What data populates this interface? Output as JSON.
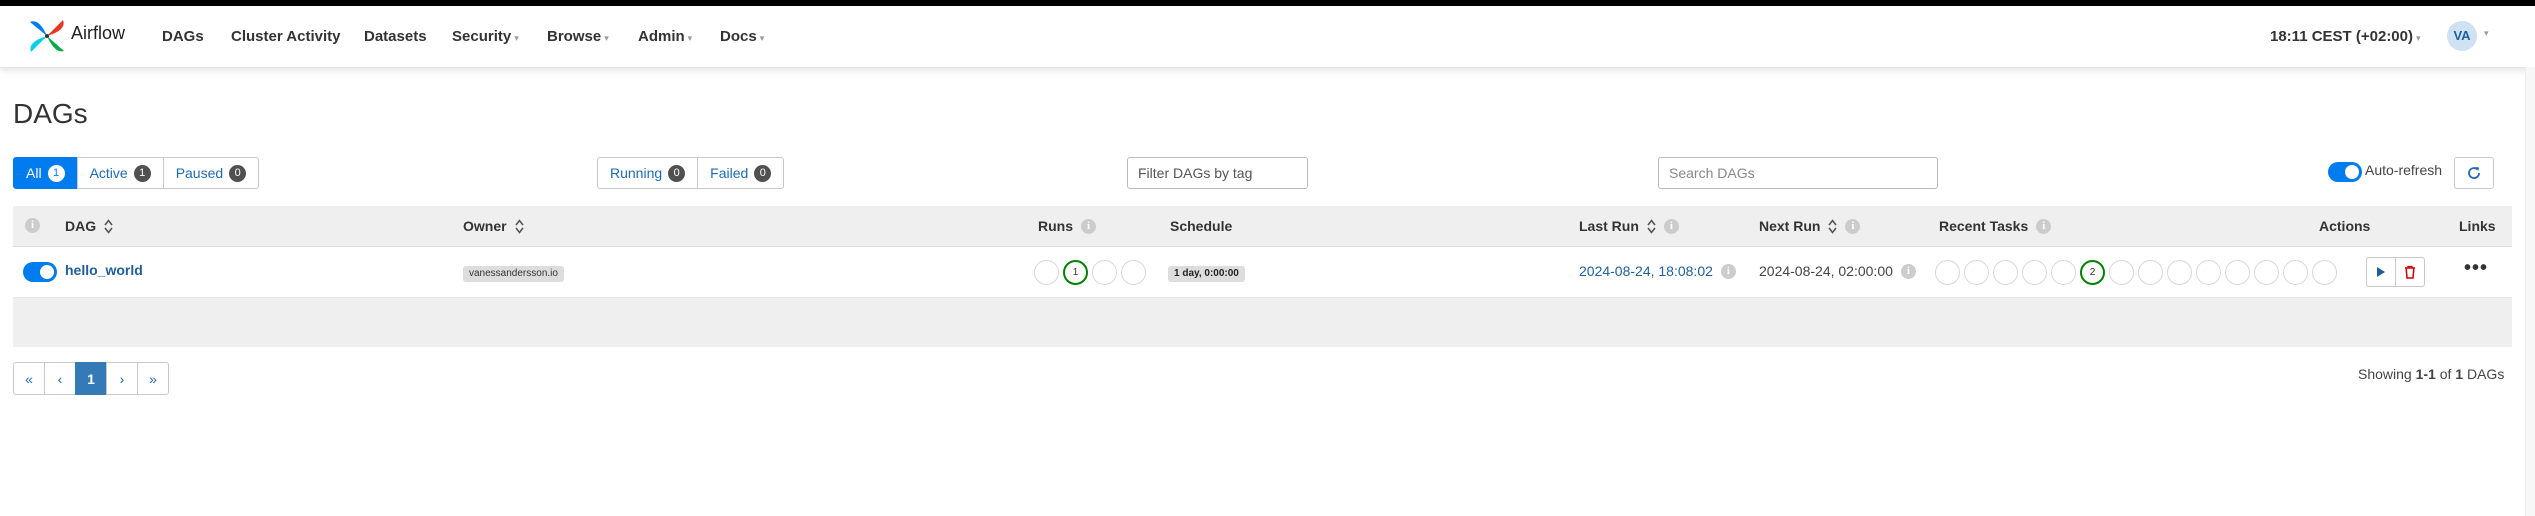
{
  "brand": {
    "name": "Airflow"
  },
  "nav": {
    "items": [
      "DAGs",
      "Cluster Activity",
      "Datasets",
      "Security",
      "Browse",
      "Admin",
      "Docs"
    ],
    "clock": "18:11 CEST (+02:00)",
    "user_initials": "VA"
  },
  "page": {
    "title": "DAGs"
  },
  "status_filter": {
    "all": {
      "label": "All",
      "count": "1"
    },
    "active": {
      "label": "Active",
      "count": "1"
    },
    "paused": {
      "label": "Paused",
      "count": "0"
    }
  },
  "run_filter": {
    "running": {
      "label": "Running",
      "count": "0"
    },
    "failed": {
      "label": "Failed",
      "count": "0"
    }
  },
  "tag_filter": {
    "placeholder": "Filter DAGs by tag"
  },
  "search": {
    "placeholder": "Search DAGs"
  },
  "auto_refresh": {
    "label": "Auto-refresh",
    "enabled": true
  },
  "table": {
    "headers": {
      "dag": "DAG",
      "owner": "Owner",
      "runs": "Runs",
      "schedule": "Schedule",
      "last_run": "Last Run",
      "next_run": "Next Run",
      "recent_tasks": "Recent Tasks",
      "actions": "Actions",
      "links": "Links"
    },
    "rows": [
      {
        "paused": false,
        "dag_id": "hello_world",
        "owner": "vanessandersson.io",
        "runs": [
          "",
          "1",
          "",
          ""
        ],
        "schedule": "1 day, 0:00:00",
        "last_run": "2024-08-24, 18:08:02",
        "next_run": "2024-08-24, 02:00:00",
        "recent_tasks": [
          "",
          "",
          "",
          "",
          "",
          "2",
          "",
          "",
          "",
          "",
          "",
          "",
          "",
          ""
        ]
      }
    ]
  },
  "pagination": {
    "first": "«",
    "prev": "‹",
    "current": "1",
    "next": "›",
    "last": "»"
  },
  "footer": {
    "showing_prefix": "Showing",
    "range": "1-1",
    "of": "of",
    "total": "1",
    "unit": "DAGs"
  },
  "colors": {
    "accent": "#017cee",
    "success": "#008000",
    "link": "#1f5e99",
    "danger": "#cc0000"
  }
}
